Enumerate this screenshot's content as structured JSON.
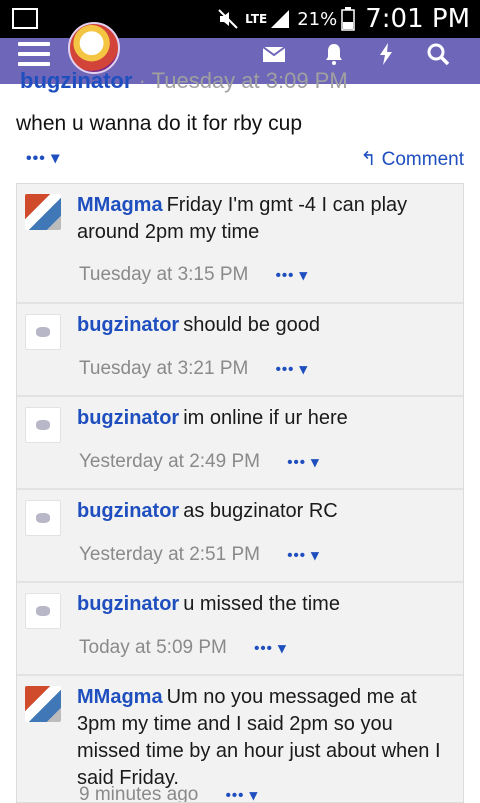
{
  "status_bar": {
    "lte": "LTE",
    "battery_percent": "21%",
    "time": "7:01 PM"
  },
  "post": {
    "author": "bugzinator",
    "separator": "·",
    "date": "Tuesday at 3:09 PM",
    "text": "when u wanna do it for rby cup",
    "more": "••• ▾",
    "comment_label": "Comment"
  },
  "comments": [
    {
      "author": "MMagma",
      "text": "Friday I'm gmt -4 I can play around 2pm my time",
      "date": "Tuesday at 3:15 PM",
      "more": "••• ▾"
    },
    {
      "author": "bugzinator",
      "text": "should be good",
      "date": "Tuesday at 3:21 PM",
      "more": "••• ▾"
    },
    {
      "author": "bugzinator",
      "text": "im online if ur here",
      "date": "Yesterday at 2:49 PM",
      "more": "••• ▾"
    },
    {
      "author": "bugzinator",
      "text": "as bugzinator RC",
      "date": "Yesterday at 2:51 PM",
      "more": "••• ▾"
    },
    {
      "author": "bugzinator",
      "text": "u missed the time",
      "date": "Today at 5:09 PM",
      "more": "••• ▾"
    },
    {
      "author": "MMagma",
      "text": "Um no you messaged me at 3pm my time and I said 2pm so you missed time by an hour just about when I said Friday.",
      "date": "9 minutes ago",
      "more": "••• ▾"
    }
  ]
}
